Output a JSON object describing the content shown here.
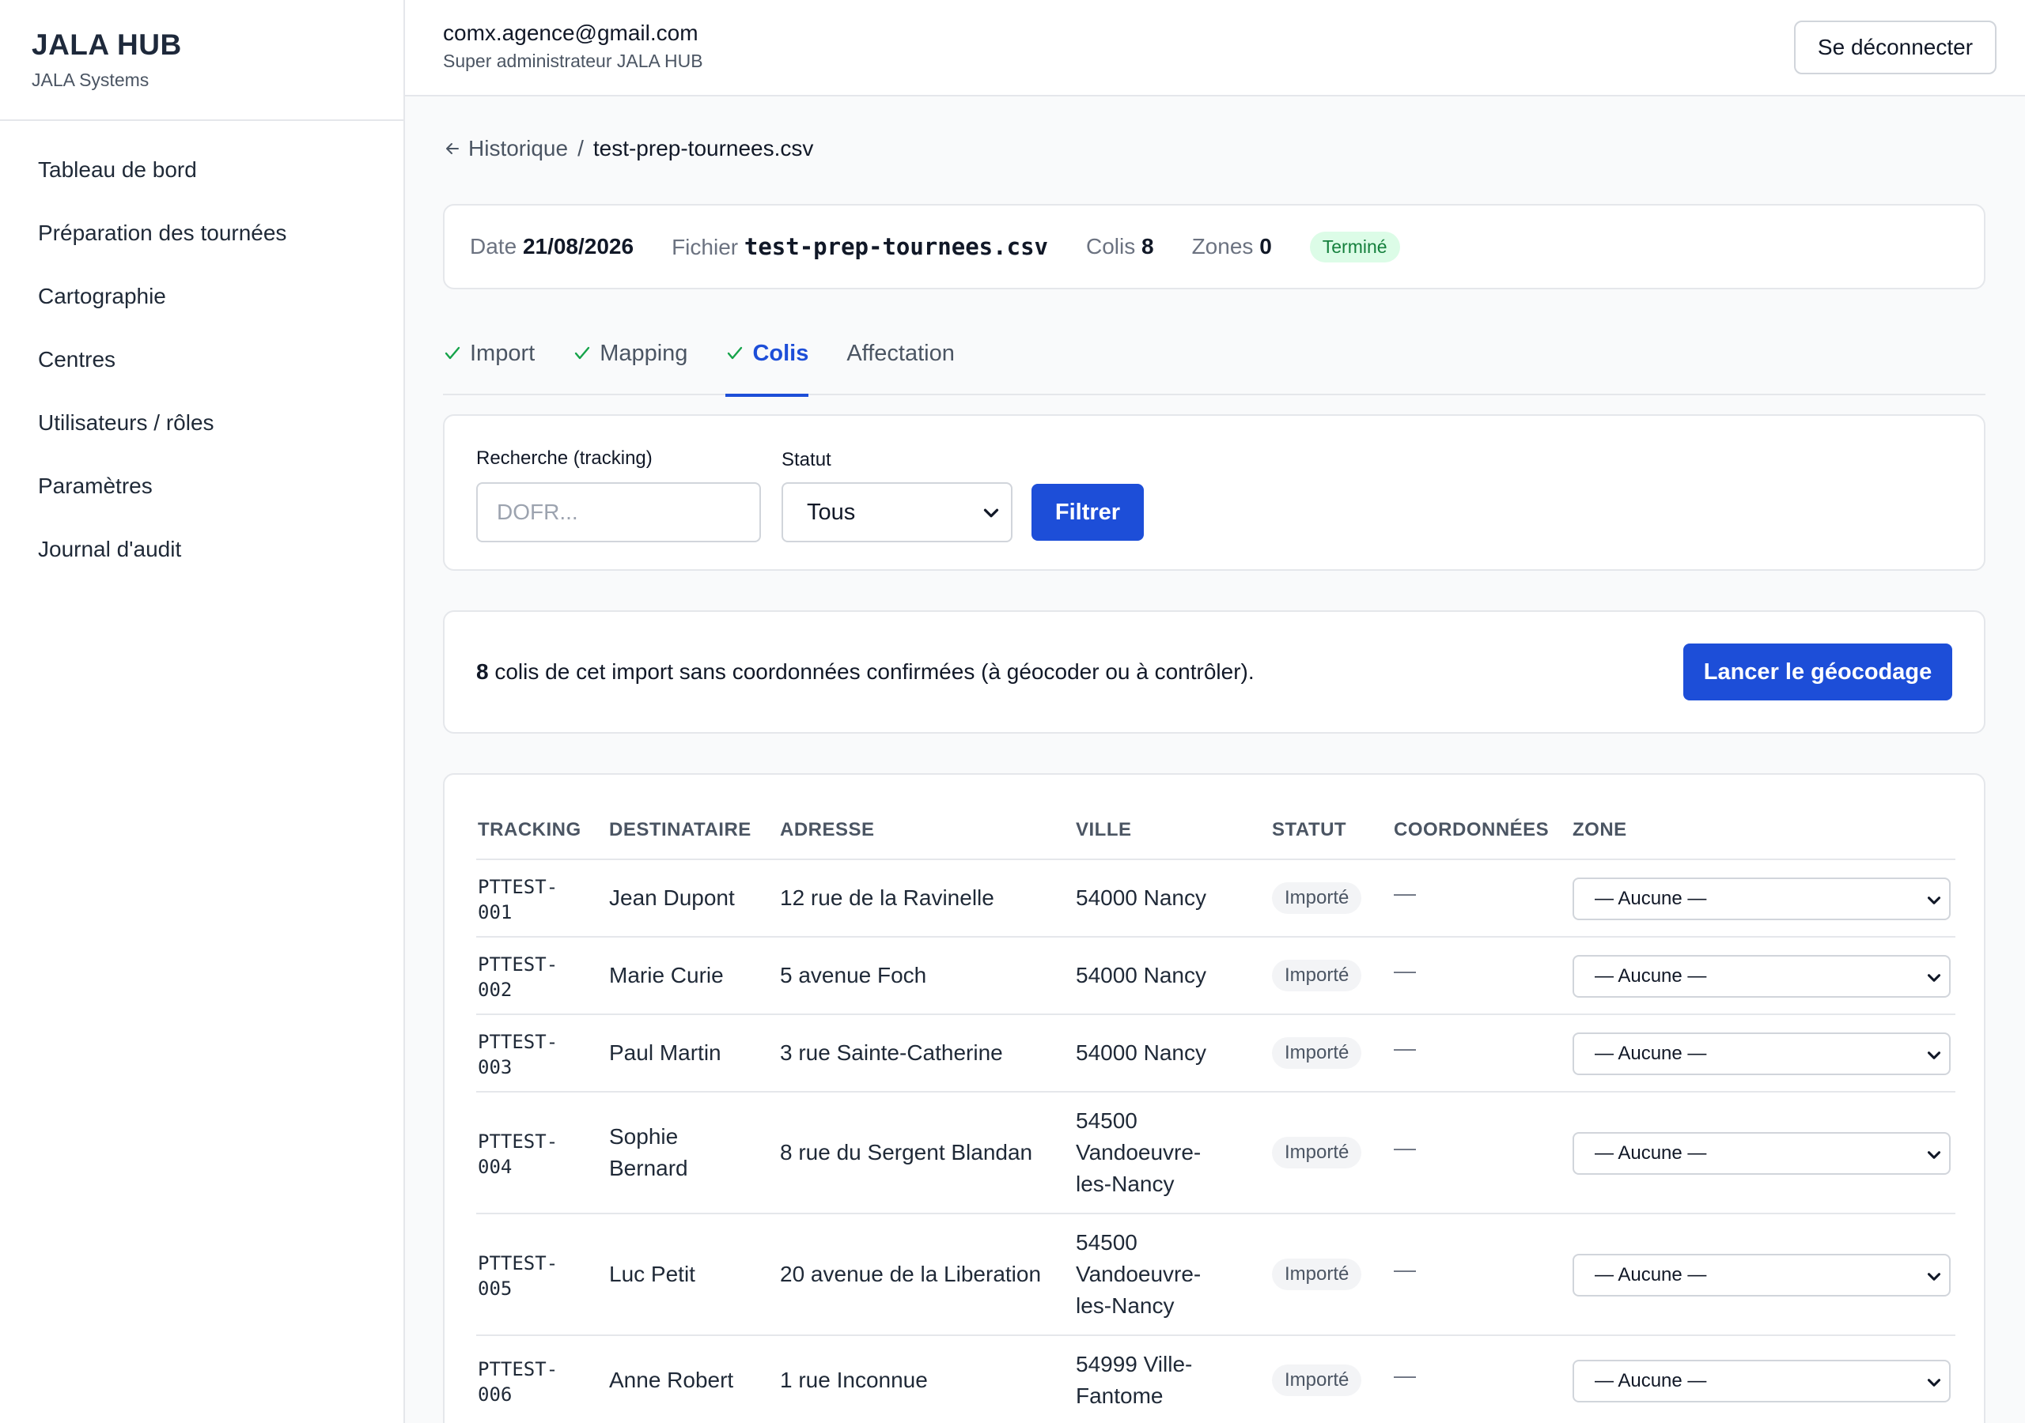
{
  "sidebar": {
    "brand_title": "JALA HUB",
    "brand_sub": "JALA Systems",
    "items": [
      {
        "label": "Tableau de bord"
      },
      {
        "label": "Préparation des tournées"
      },
      {
        "label": "Cartographie"
      },
      {
        "label": "Centres"
      },
      {
        "label": "Utilisateurs / rôles"
      },
      {
        "label": "Paramètres"
      },
      {
        "label": "Journal d'audit"
      }
    ]
  },
  "header": {
    "email": "comx.agence@gmail.com",
    "role": "Super administrateur JALA HUB",
    "logout_label": "Se déconnecter"
  },
  "breadcrumb": {
    "back_label": "Historique",
    "separator": "/",
    "current": "test-prep-tournees.csv"
  },
  "info": {
    "date_label": "Date",
    "date_value": "21/08/2026",
    "file_label": "Fichier",
    "file_value": "test-prep-tournees.csv",
    "colis_label": "Colis",
    "colis_value": "8",
    "zones_label": "Zones",
    "zones_value": "0",
    "status": "Terminé"
  },
  "tabs": [
    {
      "label": "Import",
      "done": true
    },
    {
      "label": "Mapping",
      "done": true
    },
    {
      "label": "Colis",
      "done": true,
      "active": true
    },
    {
      "label": "Affectation",
      "done": false
    }
  ],
  "filter": {
    "search_label": "Recherche (tracking)",
    "search_placeholder": "DOFR...",
    "status_label": "Statut",
    "status_value": "Tous",
    "button_label": "Filtrer"
  },
  "geocode": {
    "count": "8",
    "text": " colis de cet import sans coordonnées confirmées (à géocoder ou à contrôler).",
    "button_label": "Lancer le géocodage"
  },
  "table": {
    "headers": {
      "tracking": "TRACKING",
      "destinataire": "DESTINATAIRE",
      "adresse": "ADRESSE",
      "ville": "VILLE",
      "statut": "STATUT",
      "coordonnees": "COORDONNÉES",
      "zone": "ZONE"
    },
    "rows": [
      {
        "tracking_a": "PTTEST-",
        "tracking_b": "001",
        "name_a": "Jean Dupont",
        "name_b": "",
        "address": "12 rue de la Ravinelle",
        "city_a": "54000 Nancy",
        "city_b": "",
        "city_c": "",
        "status": "Importé",
        "coords": "—",
        "zone": "— Aucune —"
      },
      {
        "tracking_a": "PTTEST-",
        "tracking_b": "002",
        "name_a": "Marie Curie",
        "name_b": "",
        "address": "5 avenue Foch",
        "city_a": "54000 Nancy",
        "city_b": "",
        "city_c": "",
        "status": "Importé",
        "coords": "—",
        "zone": "— Aucune —"
      },
      {
        "tracking_a": "PTTEST-",
        "tracking_b": "003",
        "name_a": "Paul Martin",
        "name_b": "",
        "address": "3 rue Sainte-Catherine",
        "city_a": "54000 Nancy",
        "city_b": "",
        "city_c": "",
        "status": "Importé",
        "coords": "—",
        "zone": "— Aucune —"
      },
      {
        "tracking_a": "PTTEST-",
        "tracking_b": "004",
        "name_a": "Sophie",
        "name_b": "Bernard",
        "address": "8 rue du Sergent Blandan",
        "city_a": "54500",
        "city_b": "Vandoeuvre-",
        "city_c": "les-Nancy",
        "status": "Importé",
        "coords": "—",
        "zone": "— Aucune —"
      },
      {
        "tracking_a": "PTTEST-",
        "tracking_b": "005",
        "name_a": "Luc Petit",
        "name_b": "",
        "address": "20 avenue de la Liberation",
        "city_a": "54500",
        "city_b": "Vandoeuvre-",
        "city_c": "les-Nancy",
        "status": "Importé",
        "coords": "—",
        "zone": "— Aucune —"
      },
      {
        "tracking_a": "PTTEST-",
        "tracking_b": "006",
        "name_a": "Anne Robert",
        "name_b": "",
        "address": "1 rue Inconnue",
        "city_a": "54999 Ville-",
        "city_b": "Fantome",
        "city_c": "",
        "status": "Importé",
        "coords": "—",
        "zone": "— Aucune —"
      }
    ]
  }
}
